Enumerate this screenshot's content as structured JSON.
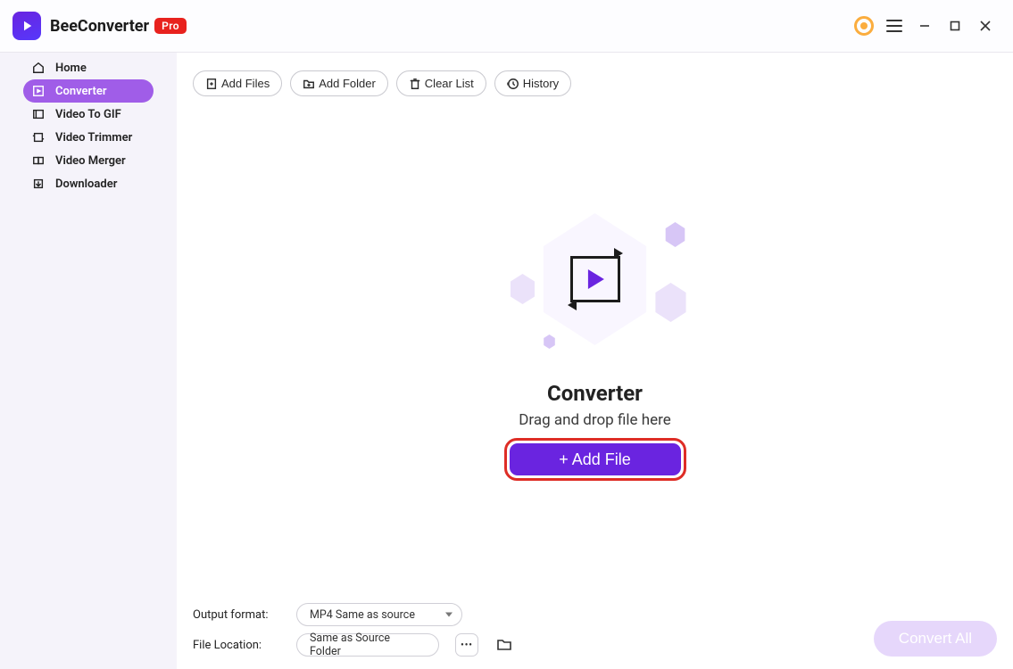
{
  "app": {
    "title": "BeeConverter",
    "badge": "Pro"
  },
  "sidebar": {
    "items": [
      {
        "id": "home",
        "label": "Home",
        "active": false
      },
      {
        "id": "converter",
        "label": "Converter",
        "active": true
      },
      {
        "id": "video-gif",
        "label": "Video To GIF",
        "active": false
      },
      {
        "id": "trimmer",
        "label": "Video Trimmer",
        "active": false
      },
      {
        "id": "merger",
        "label": "Video Merger",
        "active": false
      },
      {
        "id": "downloader",
        "label": "Downloader",
        "active": false
      }
    ]
  },
  "toolbar": {
    "add_files": "Add Files",
    "add_folder": "Add Folder",
    "clear_list": "Clear List",
    "history": "History"
  },
  "drop": {
    "title": "Converter",
    "subtitle": "Drag and drop file here",
    "button": "+ Add File"
  },
  "footer": {
    "output_label": "Output format:",
    "output_value": "MP4 Same as source",
    "location_label": "File Location:",
    "location_value": "Same as Source Folder",
    "convert_all": "Convert All"
  }
}
